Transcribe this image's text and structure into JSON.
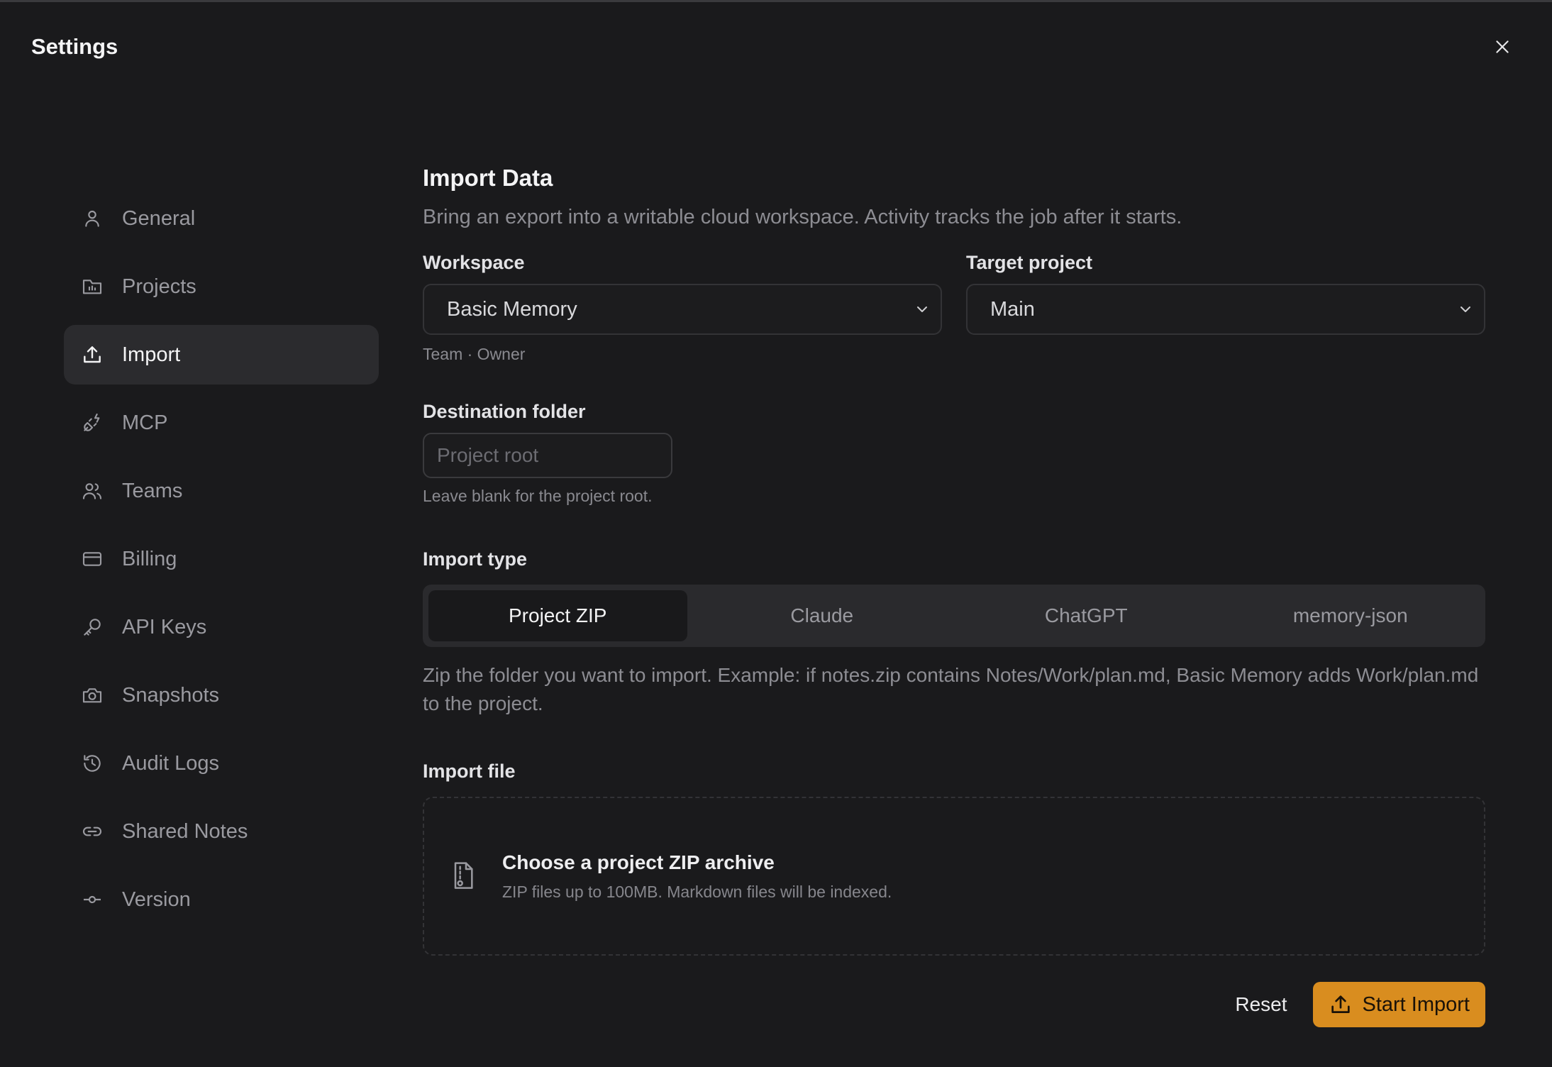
{
  "header": {
    "title": "Settings",
    "close_icon": "close-icon"
  },
  "sidebar": {
    "items": [
      {
        "label": "General",
        "icon": "user-icon",
        "active": false
      },
      {
        "label": "Projects",
        "icon": "folder-chart-icon",
        "active": false
      },
      {
        "label": "Import",
        "icon": "upload-icon",
        "active": true
      },
      {
        "label": "MCP",
        "icon": "plug-icon",
        "active": false
      },
      {
        "label": "Teams",
        "icon": "users-icon",
        "active": false
      },
      {
        "label": "Billing",
        "icon": "credit-card-icon",
        "active": false
      },
      {
        "label": "API Keys",
        "icon": "key-icon",
        "active": false
      },
      {
        "label": "Snapshots",
        "icon": "camera-icon",
        "active": false
      },
      {
        "label": "Audit Logs",
        "icon": "history-icon",
        "active": false
      },
      {
        "label": "Shared Notes",
        "icon": "link-icon",
        "active": false
      },
      {
        "label": "Version",
        "icon": "commit-icon",
        "active": false
      }
    ]
  },
  "main": {
    "title": "Import Data",
    "description": "Bring an export into a writable cloud workspace. Activity tracks the job after it starts.",
    "workspace": {
      "label": "Workspace",
      "value": "Basic Memory",
      "hint": "Team · Owner"
    },
    "target_project": {
      "label": "Target project",
      "value": "Main"
    },
    "destination": {
      "label": "Destination folder",
      "placeholder": "Project root",
      "value": "",
      "hint": "Leave blank for the project root."
    },
    "import_type": {
      "label": "Import type",
      "options": [
        "Project ZIP",
        "Claude",
        "ChatGPT",
        "memory-json"
      ],
      "selected": "Project ZIP",
      "description": "Zip the folder you want to import. Example: if notes.zip contains Notes/Work/plan.md, Basic Memory adds Work/plan.md to the project."
    },
    "import_file": {
      "label": "Import file",
      "title": "Choose a project ZIP archive",
      "subtitle": "ZIP files up to 100MB. Markdown files will be indexed."
    },
    "actions": {
      "reset": "Reset",
      "start": "Start Import"
    }
  },
  "colors": {
    "background": "#1a1a1c",
    "accent": "#d98d1f",
    "active_nav": "#2b2b2e"
  }
}
